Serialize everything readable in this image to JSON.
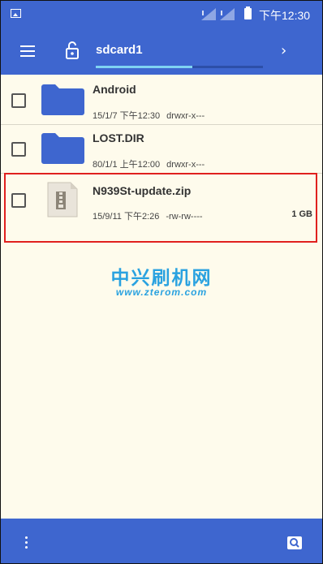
{
  "status_bar": {
    "time": "下午12:30",
    "icons": [
      "image-icon",
      "signal-icon",
      "signal-icon",
      "battery-icon"
    ]
  },
  "toolbar": {
    "path_title": "sdcard1",
    "path_progress": 0.58,
    "icons": [
      "menu-icon",
      "unlock-icon",
      "chevron-right-icon"
    ]
  },
  "files": [
    {
      "name": "Android",
      "date": "15/1/7 下午12:30",
      "perms": "drwxr-x---",
      "size": "",
      "icon": "folder-icon"
    },
    {
      "name": "LOST.DIR",
      "date": "80/1/1 上午12:00",
      "perms": "drwxr-x---",
      "size": "",
      "icon": "folder-icon"
    },
    {
      "name": "N939St-update.zip",
      "date": "15/9/11 下午2:26",
      "perms": "-rw-rw----",
      "size": "1 GB",
      "icon": "zip-icon"
    }
  ],
  "watermark": {
    "title": "中兴刷机网",
    "url": "www.zterom.com"
  },
  "bottom_bar": {
    "icons": [
      "more-vert-icon",
      "search-icon"
    ]
  },
  "colors": {
    "primary": "#3e66cf",
    "background": "#fefbec",
    "highlight_border": "#e0201e",
    "watermark": "#2aa2e0"
  }
}
